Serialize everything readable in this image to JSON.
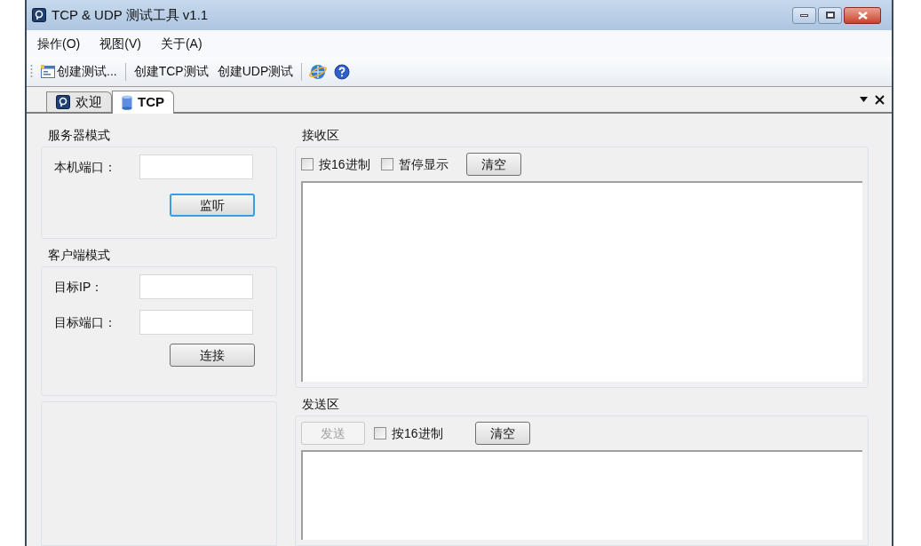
{
  "window": {
    "title": "TCP & UDP 测试工具 v1.1"
  },
  "menu": [
    {
      "label": "操作(O)"
    },
    {
      "label": "视图(V)"
    },
    {
      "label": "关于(A)"
    }
  ],
  "toolbar": [
    {
      "kind": "button",
      "label": "创建测试...",
      "icon": true
    },
    {
      "kind": "separator"
    },
    {
      "kind": "button",
      "label": "创建TCP测试",
      "icon": false
    },
    {
      "kind": "button",
      "label": "创建UDP测试",
      "icon": false
    },
    {
      "kind": "separator"
    },
    {
      "kind": "globe"
    },
    {
      "kind": "help"
    }
  ],
  "tabs": [
    {
      "label": "欢迎",
      "selected": false
    },
    {
      "label": "TCP",
      "selected": true
    }
  ],
  "server_group": {
    "title": "服务器模式",
    "fields": [
      {
        "label": "本机端口："
      }
    ],
    "button": {
      "label": "监听",
      "focused": true
    }
  },
  "client_group": {
    "title": "客户端模式",
    "fields": [
      {
        "label": "目标IP："
      },
      {
        "label": "目标端口："
      }
    ],
    "button": {
      "label": "连接",
      "focused": false
    }
  },
  "receive": {
    "title": "接收区",
    "checkboxes": [
      {
        "label": "按16进制",
        "checked": false
      },
      {
        "label": "暂停显示",
        "checked": false
      }
    ],
    "clear_button": "清空"
  },
  "send": {
    "title": "发送区",
    "send_button": {
      "label": "发送",
      "disabled": true
    },
    "checkboxes": [
      {
        "label": "按16进制",
        "checked": false
      }
    ],
    "clear_button": "清空"
  }
}
